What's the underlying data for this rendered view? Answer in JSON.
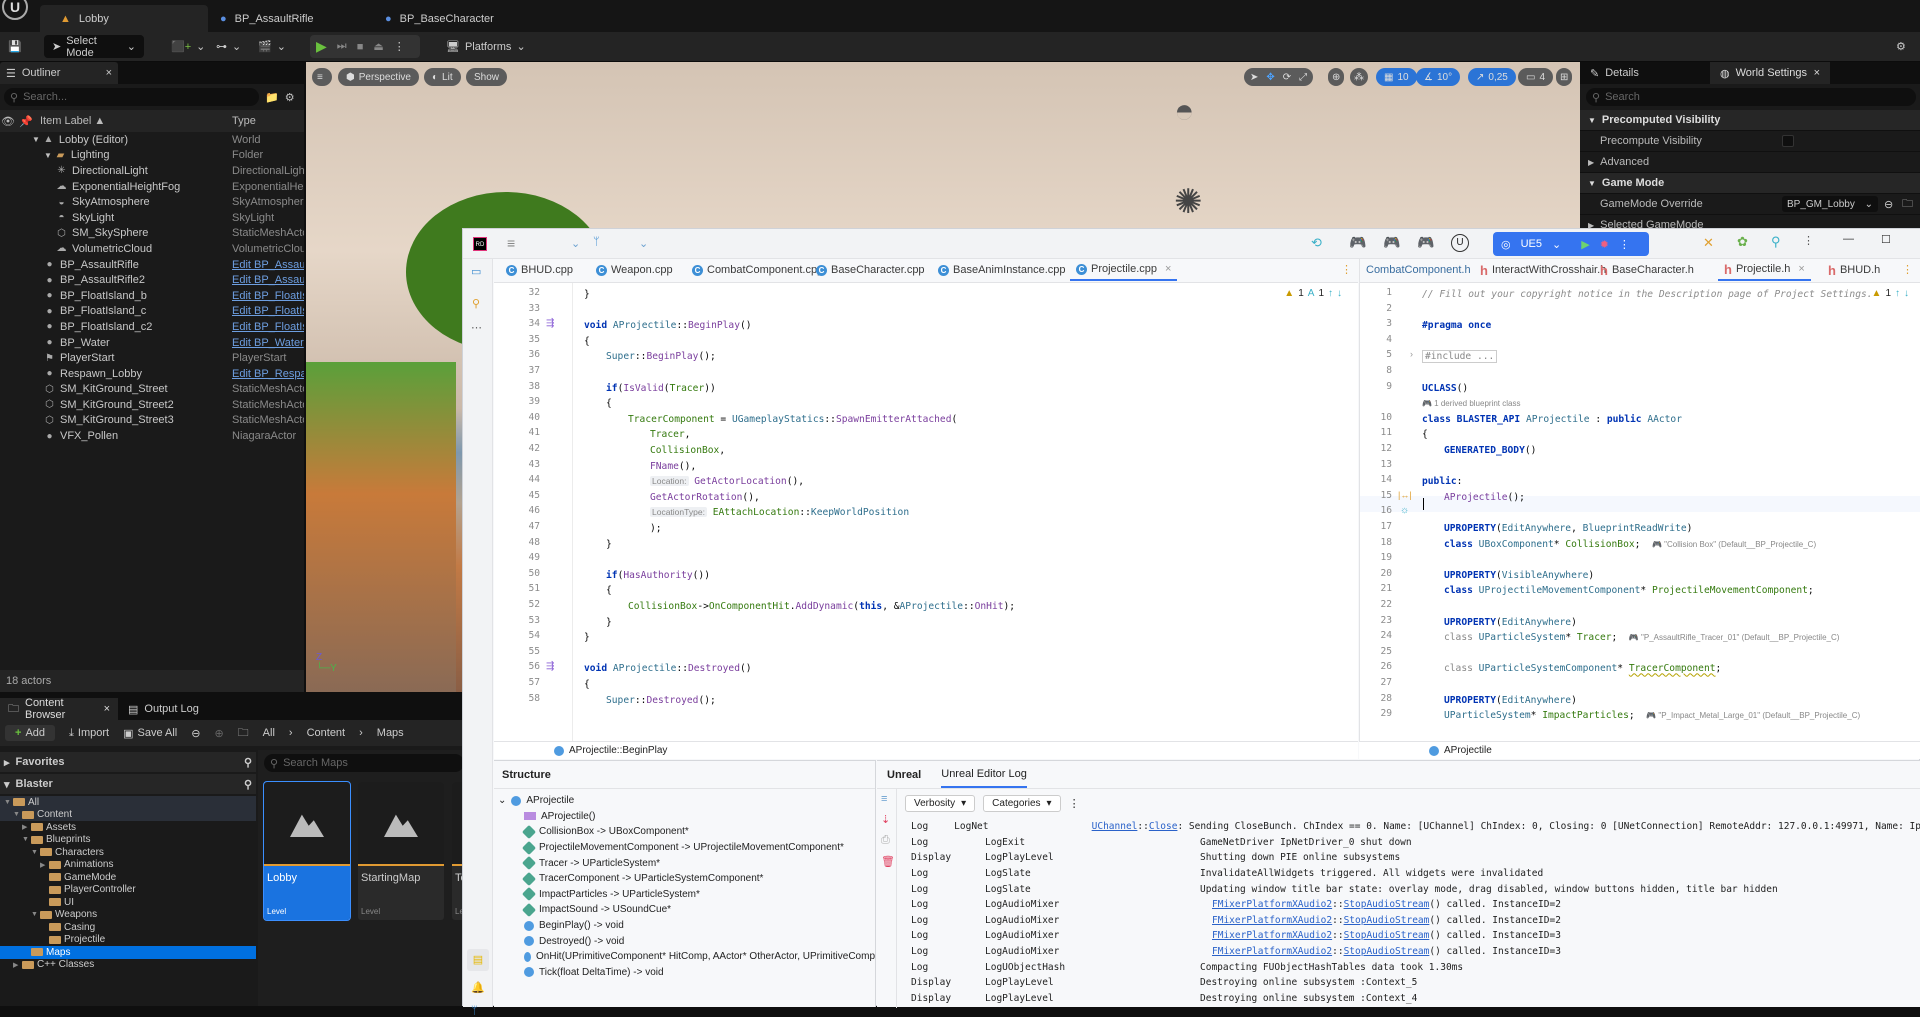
{
  "ue": {
    "doc_tabs": [
      {
        "label": "Lobby",
        "icon": "level-icon",
        "active": true
      },
      {
        "label": "BP_AssaultRifle",
        "icon": "blueprint-actor-icon",
        "active": false
      },
      {
        "label": "BP_BaseCharacter",
        "icon": "blueprint-character-icon",
        "active": false
      }
    ],
    "toolbar": {
      "select_mode": "Select Mode",
      "platforms": "Platforms"
    },
    "outliner": {
      "tab": "Outliner",
      "search_placeholder": "Search...",
      "col_label": "Item Label ▲",
      "col_type": "Type",
      "rows": [
        {
          "label": "Lobby (Editor)",
          "type": "World",
          "indent": 1,
          "icon": "level-icon",
          "link": false
        },
        {
          "label": "Lighting",
          "type": "Folder",
          "indent": 2,
          "icon": "folder-icon",
          "link": false
        },
        {
          "label": "DirectionalLight",
          "type": "DirectionalLight",
          "indent": 3,
          "icon": "light-icon",
          "link": false
        },
        {
          "label": "ExponentialHeightFog",
          "type": "ExponentialHeig",
          "indent": 3,
          "icon": "fog-icon",
          "link": false
        },
        {
          "label": "SkyAtmosphere",
          "type": "SkyAtmosphere",
          "indent": 3,
          "icon": "sky-atmosphere-icon",
          "link": false
        },
        {
          "label": "SkyLight",
          "type": "SkyLight",
          "indent": 3,
          "icon": "skylight-icon",
          "link": false
        },
        {
          "label": "SM_SkySphere",
          "type": "StaticMeshActo",
          "indent": 3,
          "icon": "static-mesh-icon",
          "link": false
        },
        {
          "label": "VolumetricCloud",
          "type": "VolumetricClouc",
          "indent": 3,
          "icon": "cloud-icon",
          "link": false
        },
        {
          "label": "BP_AssaultRifle",
          "type": "Edit BP_Assault",
          "indent": 2,
          "icon": "actor-icon",
          "link": true
        },
        {
          "label": "BP_AssaultRifle2",
          "type": "Edit BP_Assault",
          "indent": 2,
          "icon": "actor-icon",
          "link": true
        },
        {
          "label": "BP_FloatIsland_b",
          "type": "Edit BP_FloatIsl",
          "indent": 2,
          "icon": "actor-icon",
          "link": true
        },
        {
          "label": "BP_FloatIsland_c",
          "type": "Edit BP_FloatIsl",
          "indent": 2,
          "icon": "actor-icon",
          "link": true
        },
        {
          "label": "BP_FloatIsland_c2",
          "type": "Edit BP_FloatIsl",
          "indent": 2,
          "icon": "actor-icon",
          "link": true
        },
        {
          "label": "BP_Water",
          "type": "Edit BP_Water",
          "indent": 2,
          "icon": "actor-icon",
          "link": true
        },
        {
          "label": "PlayerStart",
          "type": "PlayerStart",
          "indent": 2,
          "icon": "player-start-icon",
          "link": false
        },
        {
          "label": "Respawn_Lobby",
          "type": "Edit BP_Respaw",
          "indent": 2,
          "icon": "actor-icon",
          "link": true
        },
        {
          "label": "SM_KitGround_Street",
          "type": "StaticMeshActo",
          "indent": 2,
          "icon": "static-mesh-icon",
          "link": false
        },
        {
          "label": "SM_KitGround_Street2",
          "type": "StaticMeshActo",
          "indent": 2,
          "icon": "static-mesh-icon",
          "link": false
        },
        {
          "label": "SM_KitGround_Street3",
          "type": "StaticMeshActo",
          "indent": 2,
          "icon": "static-mesh-icon",
          "link": false
        },
        {
          "label": "VFX_Pollen",
          "type": "NiagaraActor",
          "indent": 2,
          "icon": "actor-icon",
          "link": false
        }
      ],
      "status": "18 actors"
    },
    "viewport": {
      "menu": "≡",
      "perspective": "Perspective",
      "lit": "Lit",
      "show": "Show",
      "grid_snap": "10",
      "rot_snap": "10°",
      "scale_snap": "0,25",
      "camera_speed": "4"
    },
    "details": {
      "tab_details": "Details",
      "tab_world": "World Settings",
      "search_placeholder": "Search",
      "rows": [
        {
          "label": "Precomputed Visibility",
          "category": true
        },
        {
          "label": "Precompute Visibility",
          "category": false
        },
        {
          "label": "Advanced",
          "category": false
        },
        {
          "label": "Game Mode",
          "category": true
        },
        {
          "label": "GameMode Override",
          "category": false,
          "value": "BP_GM_Lobby"
        },
        {
          "label": "Selected GameMode",
          "category": false
        }
      ]
    },
    "content_browser": {
      "tab": "Content Browser",
      "tab2": "Output Log",
      "add": "Add",
      "import": "Import",
      "save_all": "Save All",
      "breadcrumb": [
        "All",
        "Content",
        "Maps"
      ],
      "favorites": "Favorites",
      "project": "Blaster",
      "search_placeholder": "Search Maps",
      "tree": [
        {
          "label": "All",
          "indent": 0,
          "caret": "▼"
        },
        {
          "label": "Content",
          "indent": 1,
          "caret": "▼"
        },
        {
          "label": "Assets",
          "indent": 2,
          "caret": "▶"
        },
        {
          "label": "Blueprints",
          "indent": 2,
          "caret": "▼"
        },
        {
          "label": "Characters",
          "indent": 3,
          "caret": "▼"
        },
        {
          "label": "Animations",
          "indent": 4,
          "caret": "▶"
        },
        {
          "label": "GameMode",
          "indent": 4,
          "caret": ""
        },
        {
          "label": "PlayerController",
          "indent": 4,
          "caret": ""
        },
        {
          "label": "UI",
          "indent": 4,
          "caret": ""
        },
        {
          "label": "Weapons",
          "indent": 3,
          "caret": "▼"
        },
        {
          "label": "Casing",
          "indent": 4,
          "caret": ""
        },
        {
          "label": "Projectile",
          "indent": 4,
          "caret": ""
        },
        {
          "label": "Maps",
          "indent": 2,
          "caret": "",
          "selected": true
        },
        {
          "label": "C++ Classes",
          "indent": 1,
          "caret": "▶"
        }
      ],
      "assets": [
        {
          "name": "Lobby",
          "kind": "Level",
          "selected": true
        },
        {
          "name": "StartingMap",
          "kind": "Level",
          "selected": false
        },
        {
          "name": "Te",
          "kind": "Le",
          "selected": false
        }
      ]
    }
  },
  "ide": {
    "config": "UE5",
    "left_tabs": [
      "BHUD.cpp",
      "Weapon.cpp",
      "CombatComponent.cpp",
      "BaseCharacter.cpp",
      "BaseAnimInstance.cpp",
      "Projectile.cpp"
    ],
    "right_tabs": [
      "CombatComponent.h",
      "InteractWithCrosshair.h",
      "BaseCharacter.h",
      "Projectile.h",
      "BHUD.h"
    ],
    "left_inspections": {
      "warnings": "1",
      "typos": "1"
    },
    "right_inspections": {
      "warnings": "1"
    },
    "left_breadcrumb": "AProjectile::BeginPlay",
    "right_breadcrumb": "AProjectile",
    "cpp_lines": [
      {
        "n": "32",
        "indent": 0,
        "html": "}"
      },
      {
        "n": "33",
        "indent": 0,
        "html": ""
      },
      {
        "n": "34",
        "indent": 0,
        "html": "<span class='kw'>void</span> <span class='typ-c'>AProjectile</span>::<span class='fn'>BeginPlay</span>()"
      },
      {
        "n": "35",
        "indent": 0,
        "html": "{"
      },
      {
        "n": "36",
        "indent": 1,
        "html": "<span class='typ-c'>Super</span>::<span class='fn'>BeginPlay</span>();"
      },
      {
        "n": "37",
        "indent": 0,
        "html": ""
      },
      {
        "n": "38",
        "indent": 1,
        "html": "<span class='kw'>if</span>(<span class='fn'>IsValid</span>(<span class='fld'>Tracer</span>))"
      },
      {
        "n": "39",
        "indent": 1,
        "html": "{"
      },
      {
        "n": "40",
        "indent": 2,
        "html": "<span class='fld'>TracerComponent</span> = <span class='typ-c'>UGameplayStatics</span>::<span class='fn'>SpawnEmitterAttached</span>("
      },
      {
        "n": "41",
        "indent": 3,
        "html": "<span class='fld'>Tracer</span>,"
      },
      {
        "n": "42",
        "indent": 3,
        "html": "<span class='fld'>CollisionBox</span>,"
      },
      {
        "n": "43",
        "indent": 3,
        "html": "<span class='fn'>FName</span>(),"
      },
      {
        "n": "44",
        "indent": 3,
        "html": "<span class='hint'>Location:</span> <span class='fn'>GetActorLocation</span>(),"
      },
      {
        "n": "45",
        "indent": 3,
        "html": "<span class='fn'>GetActorRotation</span>(),"
      },
      {
        "n": "46",
        "indent": 3,
        "html": "<span class='hint'>LocationType:</span> <span class='fld'>EAttachLocation</span>::<span class='typ-c'>KeepWorldPosition</span>"
      },
      {
        "n": "47",
        "indent": 3,
        "html": ");"
      },
      {
        "n": "48",
        "indent": 1,
        "html": "}"
      },
      {
        "n": "49",
        "indent": 0,
        "html": ""
      },
      {
        "n": "50",
        "indent": 1,
        "html": "<span class='kw'>if</span>(<span class='fn'>HasAuthority</span>())"
      },
      {
        "n": "51",
        "indent": 1,
        "html": "{"
      },
      {
        "n": "52",
        "indent": 2,
        "html": "<span class='fld'>CollisionBox</span>-&gt;<span class='fld'>OnComponentHit</span>.<span class='fn'>AddDynamic</span>(<span class='kw'>this</span>, &amp;<span class='typ-c'>AProjectile</span>::<span class='fn'>OnHit</span>);"
      },
      {
        "n": "53",
        "indent": 1,
        "html": "}"
      },
      {
        "n": "54",
        "indent": 0,
        "html": "}"
      },
      {
        "n": "55",
        "indent": 0,
        "html": ""
      },
      {
        "n": "56",
        "indent": 0,
        "html": "<span class='kw'>void</span> <span class='typ-c'>AProjectile</span>::<span class='fn'>Destroyed</span>()"
      },
      {
        "n": "57",
        "indent": 0,
        "html": "{"
      },
      {
        "n": "58",
        "indent": 1,
        "html": "<span class='typ-c'>Super</span>::<span class='fn'>Destroyed</span>();"
      }
    ],
    "h_lines": [
      {
        "n": "1",
        "indent": 0,
        "html": "<span class='cmt'>// Fill out your copyright notice in the Description page of Project Settings.</span>"
      },
      {
        "n": "2",
        "indent": 0,
        "html": ""
      },
      {
        "n": "3",
        "indent": 0,
        "html": "<span class='kw'>#pragma once</span>"
      },
      {
        "n": "4",
        "indent": 0,
        "html": ""
      },
      {
        "n": "5",
        "indent": 0,
        "html": "<span class='grey' style='border:1px solid #ccc;padding:0 2px'>#include ...</span>"
      },
      {
        "n": "8",
        "indent": 0,
        "html": ""
      },
      {
        "n": "9",
        "indent": 0,
        "html": "<span class='kw'>UCLASS</span>()"
      },
      {
        "n": "",
        "indent": 0,
        "html": "<span class='ue-hint'>🎮 1 derived blueprint class</span>"
      },
      {
        "n": "10",
        "indent": 0,
        "html": "<span class='kw'>class</span> <span class='kw'>BLASTER_API</span> <span class='typ-c'>AProjectile</span> : <span class='kw'>public</span> <span class='typ-c'>AActor</span>"
      },
      {
        "n": "11",
        "indent": 0,
        "html": "{"
      },
      {
        "n": "12",
        "indent": 1,
        "html": "<span class='kw'>GENERATED_BODY</span>()"
      },
      {
        "n": "13",
        "indent": 0,
        "html": ""
      },
      {
        "n": "14",
        "indent": 0,
        "html": "<span class='kw'>public</span>:"
      },
      {
        "n": "15",
        "indent": 1,
        "html": "<span class='fn'>AProjectile</span>();"
      },
      {
        "n": "16",
        "indent": 0,
        "html": ""
      },
      {
        "n": "17",
        "indent": 1,
        "html": "<span class='kw'>UPROPERTY</span>(<span class='typ-c'>EditAnywhere</span>, <span class='typ-c'>BlueprintReadWrite</span>)"
      },
      {
        "n": "18",
        "indent": 1,
        "html": "<span class='kw'>class</span> <span class='typ-c'>UBoxComponent</span>* <span class='fld'>CollisionBox</span>;  <span class='ue-hint'>🎮 \"Collision Box\" (Default__BP_Projectile_C)</span>"
      },
      {
        "n": "19",
        "indent": 0,
        "html": ""
      },
      {
        "n": "20",
        "indent": 1,
        "html": "<span class='kw'>UPROPERTY</span>(<span class='typ-c'>VisibleAnywhere</span>)"
      },
      {
        "n": "21",
        "indent": 1,
        "html": "<span class='kw'>class</span> <span class='typ-c'>UProjectileMovementComponent</span>* <span class='fld'>ProjectileMovementComponent</span>;"
      },
      {
        "n": "22",
        "indent": 0,
        "html": ""
      },
      {
        "n": "23",
        "indent": 1,
        "html": "<span class='kw'>UPROPERTY</span>(<span class='typ-c'>EditAnywhere</span>)"
      },
      {
        "n": "24",
        "indent": 1,
        "html": "<span class='grey'>class</span> <span class='typ-c'>UParticleSystem</span>* <span class='fld'>Tracer</span>;  <span class='ue-hint'>🎮 \"P_AssaultRifle_Tracer_01\" (Default__BP_Projectile_C)</span>"
      },
      {
        "n": "25",
        "indent": 0,
        "html": ""
      },
      {
        "n": "26",
        "indent": 1,
        "html": "<span class='grey'>class</span> <span class='typ-c'>UParticleSystemComponent</span>* <span class='fld' style='text-decoration:underline wavy #b5a200'>TracerComponent</span>;"
      },
      {
        "n": "27",
        "indent": 0,
        "html": ""
      },
      {
        "n": "28",
        "indent": 1,
        "html": "<span class='kw'>UPROPERTY</span>(<span class='typ-c'>EditAnywhere</span>)"
      },
      {
        "n": "29",
        "indent": 1,
        "html": "<span class='typ-c'>UParticleSystem</span>* <span class='fld'>ImpactParticles</span>;  <span class='ue-hint'>🎮 \"P_Impact_Metal_Large_01\" (Default__BP_Projectile_C)</span>"
      }
    ],
    "structure": {
      "title": "Structure",
      "root": "AProjectile",
      "items": [
        {
          "label": "AProjectile()",
          "icon": "constructor-icon"
        },
        {
          "label": "CollisionBox -> UBoxComponent*",
          "icon": "field-icon"
        },
        {
          "label": "ProjectileMovementComponent -> UProjectileMovementComponent*",
          "icon": "field-icon"
        },
        {
          "label": "Tracer -> UParticleSystem*",
          "icon": "field-icon"
        },
        {
          "label": "TracerComponent -> UParticleSystemComponent*",
          "icon": "field-icon"
        },
        {
          "label": "ImpactParticles -> UParticleSystem*",
          "icon": "field-icon"
        },
        {
          "label": "ImpactSound -> USoundCue*",
          "icon": "field-icon"
        },
        {
          "label": "BeginPlay() -> void",
          "icon": "method-icon"
        },
        {
          "label": "Destroyed() -> void",
          "icon": "method-icon"
        },
        {
          "label": "OnHit(UPrimitiveComponent* HitComp, AActor* OtherActor, UPrimitiveComp",
          "icon": "method-icon"
        },
        {
          "label": "Tick(float DeltaTime) -> void",
          "icon": "method-icon"
        }
      ]
    },
    "log": {
      "tab_unreal": "Unreal",
      "tab_editor_log": "Unreal Editor Log",
      "verbosity": "Verbosity",
      "categories": "Categories",
      "rows": [
        {
          "verb": "Log",
          "cat": "LogNet",
          "msg_html": "<span class='lnk'>UChannel</span>::<span class='lnk'>Close</span>: Sending CloseBunch. ChIndex == 0. Name: [UChannel] ChIndex: 0, Closing: 0 [UNetConnection] RemoteAddr: 127.0.0.1:49971, Name: Ip"
        },
        {
          "verb": "Log",
          "cat": "LogExit",
          "msg_html": "GameNetDriver IpNetDriver_0 shut down"
        },
        {
          "verb": "Display",
          "cat": "LogPlayLevel",
          "msg_html": "Shutting down PIE online subsystems"
        },
        {
          "verb": "Log",
          "cat": "LogSlate",
          "msg_html": "InvalidateAllWidgets triggered.  All widgets were invalidated"
        },
        {
          "verb": "Log",
          "cat": "LogSlate",
          "msg_html": "Updating window title bar state: overlay mode, drag disabled, window buttons hidden, title bar hidden"
        },
        {
          "verb": "Log",
          "cat": "LogAudioMixer",
          "msg_html": "<span class='lnk'>FMixerPlatformXAudio2</span>::<span class='lnk'>StopAudioStream</span>() called. InstanceID=2"
        },
        {
          "verb": "Log",
          "cat": "LogAudioMixer",
          "msg_html": "<span class='lnk'>FMixerPlatformXAudio2</span>::<span class='lnk'>StopAudioStream</span>() called. InstanceID=2"
        },
        {
          "verb": "Log",
          "cat": "LogAudioMixer",
          "msg_html": "<span class='lnk'>FMixerPlatformXAudio2</span>::<span class='lnk'>StopAudioStream</span>() called. InstanceID=3"
        },
        {
          "verb": "Log",
          "cat": "LogAudioMixer",
          "msg_html": "<span class='lnk'>FMixerPlatformXAudio2</span>::<span class='lnk'>StopAudioStream</span>() called. InstanceID=3"
        },
        {
          "verb": "Log",
          "cat": "LogUObjectHash",
          "msg_html": "Compacting FUObjectHashTables data took   1.30ms"
        },
        {
          "verb": "Display",
          "cat": "LogPlayLevel",
          "msg_html": "Destroying online subsystem :Context_5"
        },
        {
          "verb": "Display",
          "cat": "LogPlayLevel",
          "msg_html": "Destroying online subsystem :Context_4"
        }
      ]
    }
  }
}
